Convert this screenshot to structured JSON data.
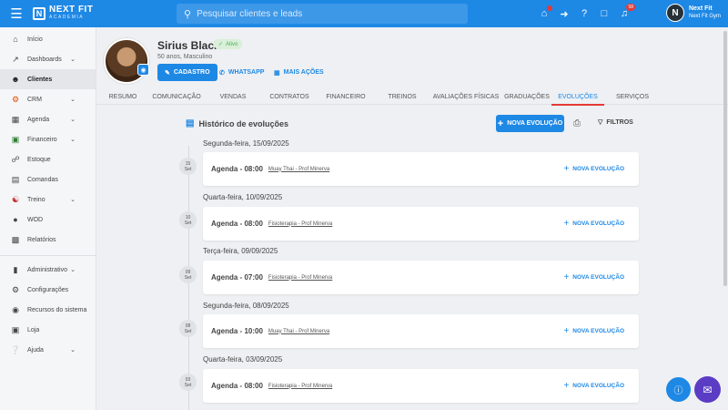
{
  "topbar": {
    "brand": "NEXT FIT",
    "brand_sub": "ACADEMIA",
    "search_placeholder": "Pesquisar clientes e leads",
    "notifications_badge": "58",
    "user_name": "Next Fit",
    "user_company": "Next Fit Gym",
    "accent": "#1e88e5"
  },
  "sidebar": {
    "items": [
      {
        "label": "Início",
        "icon": "home-icon"
      },
      {
        "label": "Dashboards",
        "icon": "chart-icon",
        "chevron": true
      },
      {
        "label": "Clientes",
        "icon": "users-icon",
        "active": true
      },
      {
        "label": "CRM",
        "icon": "crm-icon",
        "chevron": true
      },
      {
        "label": "Agenda",
        "icon": "calendar-icon",
        "chevron": true
      },
      {
        "label": "Financeiro",
        "icon": "money-icon",
        "chevron": true
      },
      {
        "label": "Estoque",
        "icon": "cart-icon"
      },
      {
        "label": "Comandas",
        "icon": "receipt-icon"
      },
      {
        "label": "Treino",
        "icon": "dumbbell-icon",
        "chevron": true
      },
      {
        "label": "WOD",
        "icon": "kettlebell-icon"
      },
      {
        "label": "Relatórios",
        "icon": "report-icon"
      }
    ],
    "items2": [
      {
        "label": "Administrativo",
        "icon": "admin-icon",
        "chevron": true
      },
      {
        "label": "Configurações",
        "icon": "gear-icon"
      },
      {
        "label": "Recursos do sistema",
        "icon": "toggle-icon"
      },
      {
        "label": "Loja",
        "icon": "store-icon"
      },
      {
        "label": "Ajuda",
        "icon": "help-icon",
        "chevron": true
      }
    ]
  },
  "profile": {
    "name": "Sirius Black",
    "status": "Ativo",
    "info": "50 anos, Masculino",
    "btn_cadastro": "CADASTRO",
    "btn_whatsapp": "WHATSAPP",
    "btn_mais": "MAIS AÇÕES"
  },
  "tabs": [
    {
      "label": "RESUMO"
    },
    {
      "label": "COMUNICAÇÃO"
    },
    {
      "label": "VENDAS"
    },
    {
      "label": "CONTRATOS"
    },
    {
      "label": "FINANCEIRO"
    },
    {
      "label": "TREINOS"
    },
    {
      "label": "AVALIAÇÕES FÍSICAS"
    },
    {
      "label": "GRADUAÇÕES"
    },
    {
      "label": "EVOLUÇÕES",
      "active": true
    },
    {
      "label": "SERVIÇOS"
    }
  ],
  "main": {
    "title": "Histórico de evoluções",
    "btn_nova": "NOVA EVOLUÇÃO",
    "btn_filtros": "FILTROS",
    "entries": [
      {
        "day": "Segunda-feira, 15/09/2025",
        "num": "15",
        "dow": "Set",
        "agenda": "Agenda - 08:00",
        "activity": "Muay Thai - Prof Minerva",
        "action": "NOVA EVOLUÇÃO"
      },
      {
        "day": "Quarta-feira, 10/09/2025",
        "num": "10",
        "dow": "Set",
        "agenda": "Agenda - 08:00",
        "activity": "Fisioterapia - Prof Minerva",
        "action": "NOVA EVOLUÇÃO"
      },
      {
        "day": "Terça-feira, 09/09/2025",
        "num": "09",
        "dow": "Set",
        "agenda": "Agenda - 07:00",
        "activity": "Fisioterapia - Prof Minerva",
        "action": "NOVA EVOLUÇÃO"
      },
      {
        "day": "Segunda-feira, 08/09/2025",
        "num": "08",
        "dow": "Set",
        "agenda": "Agenda - 10:00",
        "activity": "Muay Thai - Prof Minerva",
        "action": "NOVA EVOLUÇÃO"
      },
      {
        "day": "Quarta-feira, 03/09/2025",
        "num": "03",
        "dow": "Set",
        "agenda": "Agenda - 08:00",
        "activity": "Fisioterapia - Prof Minerva",
        "action": "NOVA EVOLUÇÃO"
      }
    ]
  }
}
